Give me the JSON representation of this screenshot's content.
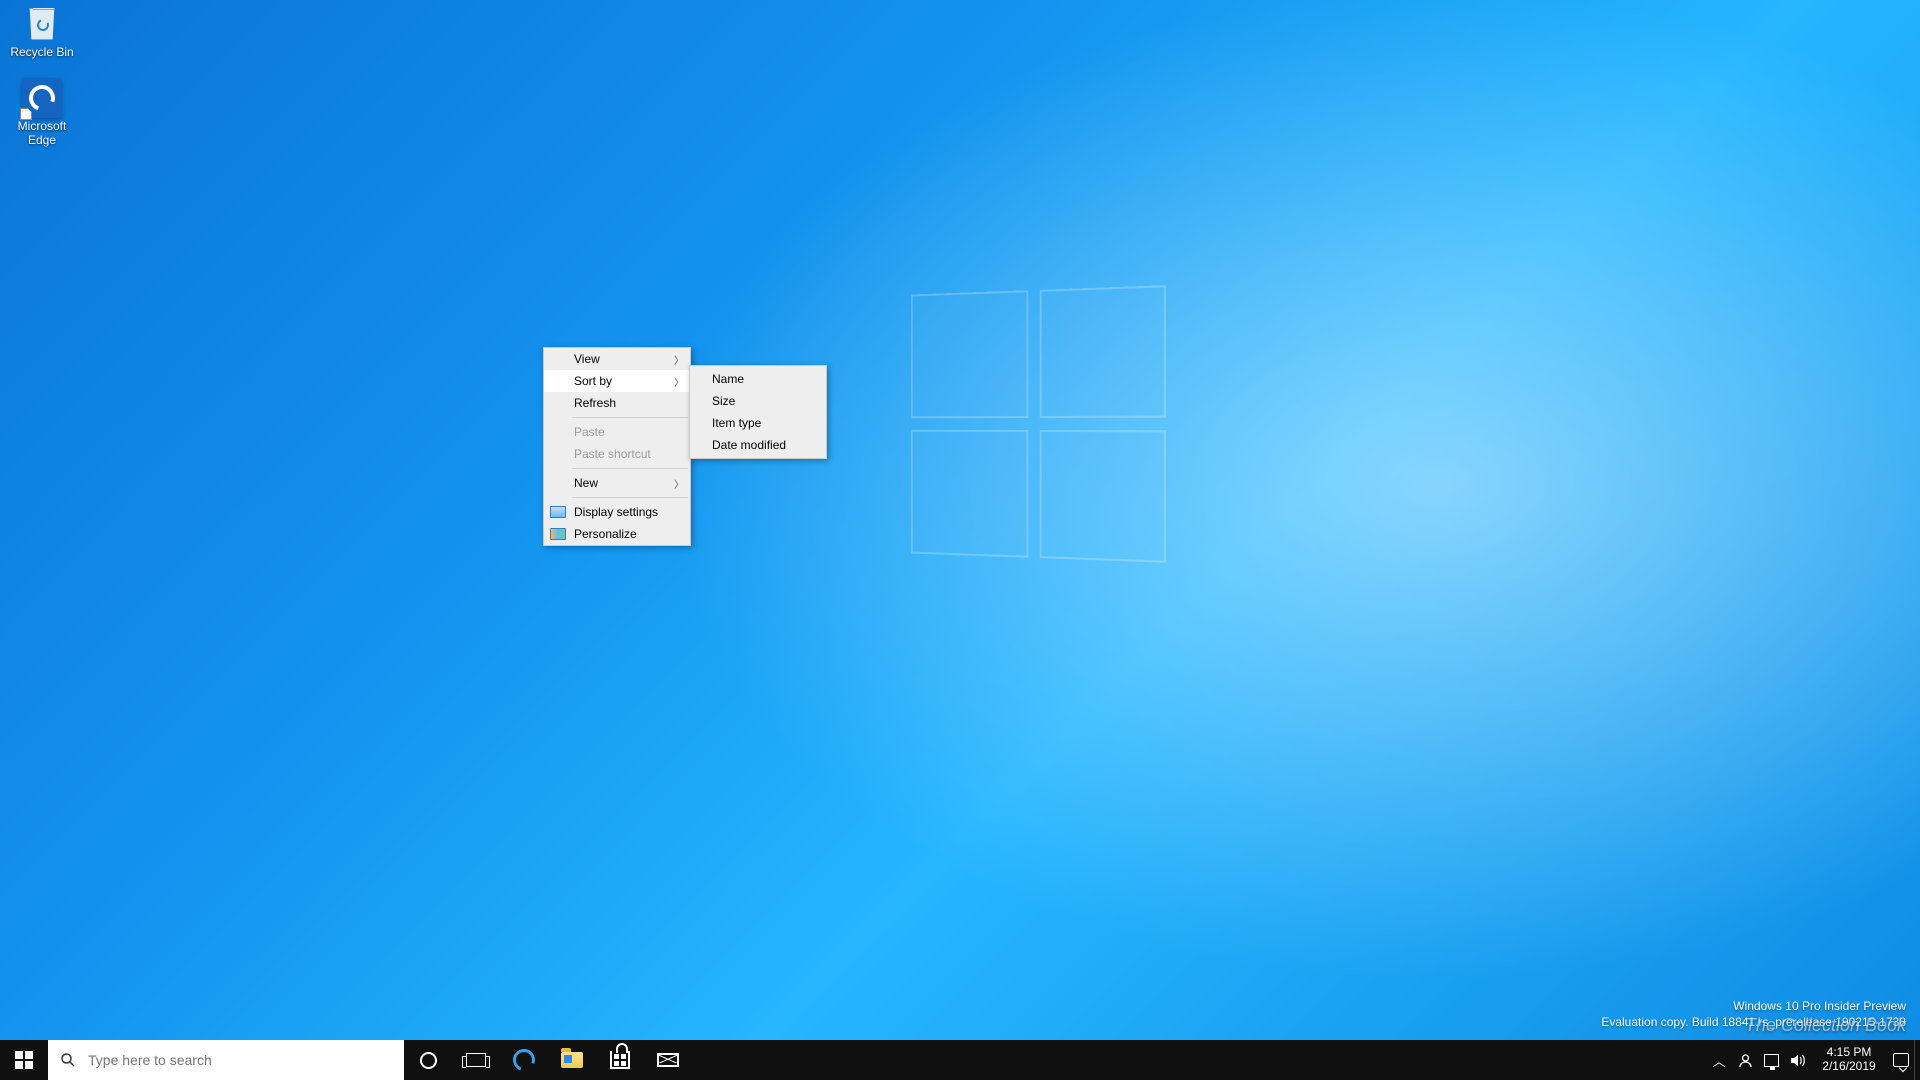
{
  "desktop": {
    "icons": [
      {
        "name": "recycle-bin",
        "label": "Recycle Bin"
      },
      {
        "name": "edge-shortcut",
        "label": "Microsoft Edge"
      }
    ]
  },
  "context_menu": {
    "items": [
      {
        "label": "View",
        "submenu": true
      },
      {
        "label": "Sort by",
        "submenu": true,
        "hover": true
      },
      {
        "label": "Refresh"
      },
      {
        "sep": true
      },
      {
        "label": "Paste",
        "disabled": true
      },
      {
        "label": "Paste shortcut",
        "disabled": true
      },
      {
        "sep": true
      },
      {
        "label": "New",
        "submenu": true
      },
      {
        "sep": true
      },
      {
        "label": "Display settings",
        "icon": "display"
      },
      {
        "label": "Personalize",
        "icon": "personalize"
      }
    ],
    "sort_by_submenu": [
      {
        "label": "Name"
      },
      {
        "label": "Size"
      },
      {
        "label": "Item type"
      },
      {
        "label": "Date modified"
      }
    ]
  },
  "watermark": {
    "line1": "Windows 10 Pro Insider Preview",
    "line2": "Evaluation copy. Build 18841.rs_prerelease.190215-1738"
  },
  "brand_overlay": "The Collection Book",
  "taskbar": {
    "search_placeholder": "Type here to search",
    "pinned": [
      {
        "name": "edge",
        "title": "Microsoft Edge"
      },
      {
        "name": "file-explorer",
        "title": "File Explorer"
      },
      {
        "name": "store",
        "title": "Microsoft Store"
      },
      {
        "name": "mail",
        "title": "Mail"
      }
    ],
    "tray": {
      "time": "4:15 PM",
      "date": "2/16/2019"
    }
  }
}
